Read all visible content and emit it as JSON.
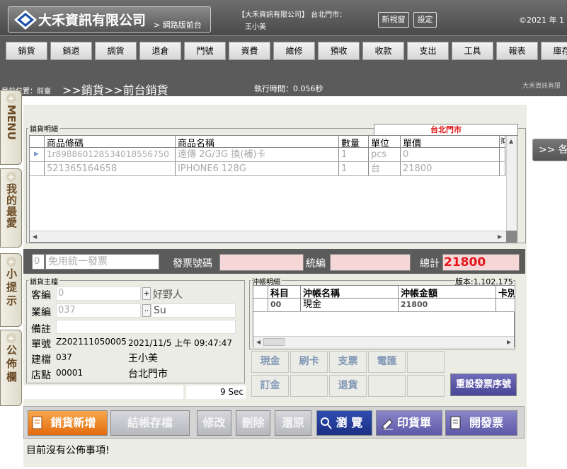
{
  "header": {
    "logo_name": "大禾資訊有限公司",
    "logo_sub": "> 網路版前台",
    "company_line": "【大禾資訊有限公司】 台北門市：",
    "user": "王小美",
    "new_window": "新視窗",
    "settings": "設定",
    "copyright": "©2021 年 1"
  },
  "nav": [
    "銷貨",
    "銷退",
    "調貨",
    "退倉",
    "門號",
    "資費",
    "維修",
    "預收",
    "收款",
    "支出",
    "工具",
    "報表",
    "庫存"
  ],
  "breadcrumb": {
    "label": "目前位置：前臺",
    "path": ">>銷貨>>前台銷貨",
    "exec_time": "執行時間：0.056秒",
    "brand": "大禾資訊有限"
  },
  "side_tabs": [
    {
      "label": "MENU"
    },
    {
      "label": "我的最愛"
    },
    {
      "label": "小提示"
    },
    {
      "label": "公佈欄"
    }
  ],
  "right_button": ">> 各",
  "detail": {
    "legend": "銷貨明細",
    "store_tab": "台北門市",
    "columns": [
      "商品條碼",
      "商品名稱",
      "數量",
      "單位",
      "單價",
      "扣"
    ],
    "rows": [
      {
        "barcode": "1r898860128534018556750",
        "name": "遠傳 2G/3G 換(補)卡",
        "qty": "1",
        "unit": "pcs",
        "price": "0"
      },
      {
        "barcode": "521365164658",
        "name": "IPHONE6 128G",
        "qty": "1",
        "unit": "台",
        "price": "21800"
      }
    ]
  },
  "invoice": {
    "type_code": "0",
    "type_name": "免用統一發票",
    "invoice_no_label": "發票號碼",
    "tax_id_label": "統編",
    "total_label": "總計",
    "total_value": "21800"
  },
  "master": {
    "legend": "銷貨主檔",
    "customer_label": "客編",
    "customer_code": "0",
    "customer_name": "好野人",
    "sales_label": "業編",
    "sales_code": "037",
    "sales_name": "Su",
    "note_label": "備註",
    "order_label": "單號",
    "order_no": "Z202111050005",
    "order_time": "2021/11/5 上午 09:47:47",
    "creator_label": "建檔",
    "creator_code": "037",
    "creator_name": "王小美",
    "store_label": "店點",
    "store_code": "00001",
    "store_name": "台北門市",
    "timer": "9 Sec"
  },
  "settlement": {
    "legend": "沖帳明細",
    "version": "版本:1.102.175",
    "columns": [
      "科目",
      "沖帳名稱",
      "沖帳金額",
      "卡別"
    ],
    "rows": [
      {
        "code": "00",
        "name": "現金",
        "amount": "21800"
      }
    ]
  },
  "pay_buttons": [
    "現金",
    "刷卡",
    "支票",
    "電匯",
    "",
    "訂金",
    "",
    "退貨",
    "",
    ""
  ],
  "reset_button": "重設發票序號",
  "actions": {
    "new_sale": "銷貨新增",
    "checkout": "結帳存檔",
    "edit": "修改",
    "delete": "刪除",
    "restore": "還原",
    "browse": "瀏 覽",
    "print_goods": "印貨單",
    "open_invoice": "開發票"
  },
  "notice": "目前沒有公佈事項!"
}
